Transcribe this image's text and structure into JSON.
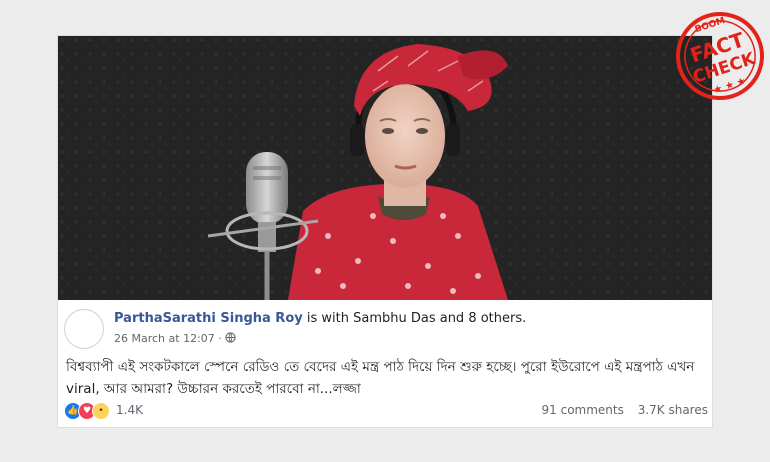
{
  "post": {
    "author": "ParthaSarathi Singha Roy",
    "with_text": " is with Sambhu Das and 8 others.",
    "timestamp": "26 March at 12:07 · ",
    "body": "বিশ্বব্যাপী এই সংকটকালে স্পেনে রেডিও তে বেদের এই মন্ত্র পাঠ দিয়ে দিন শুরু হচ্ছে। পুরো ইউরোপে এই মন্ত্রপাঠ এখন viral, আর আমরা? উচ্চারন করতেই পারবো না...লজ্জা",
    "reactions": {
      "icons": [
        "like-icon",
        "love-icon",
        "wow-icon"
      ],
      "count": "1.4K"
    },
    "comments": "91 comments",
    "shares": "3.7K shares"
  },
  "stamp": {
    "brand": "BOOM",
    "line1": "FACT",
    "line2": "CHECK",
    "color": "#e2231a"
  },
  "video": {
    "bg_color": "#2a2a2a",
    "scarf_color": "#c8283a",
    "shirt_color": "#c8283a"
  }
}
